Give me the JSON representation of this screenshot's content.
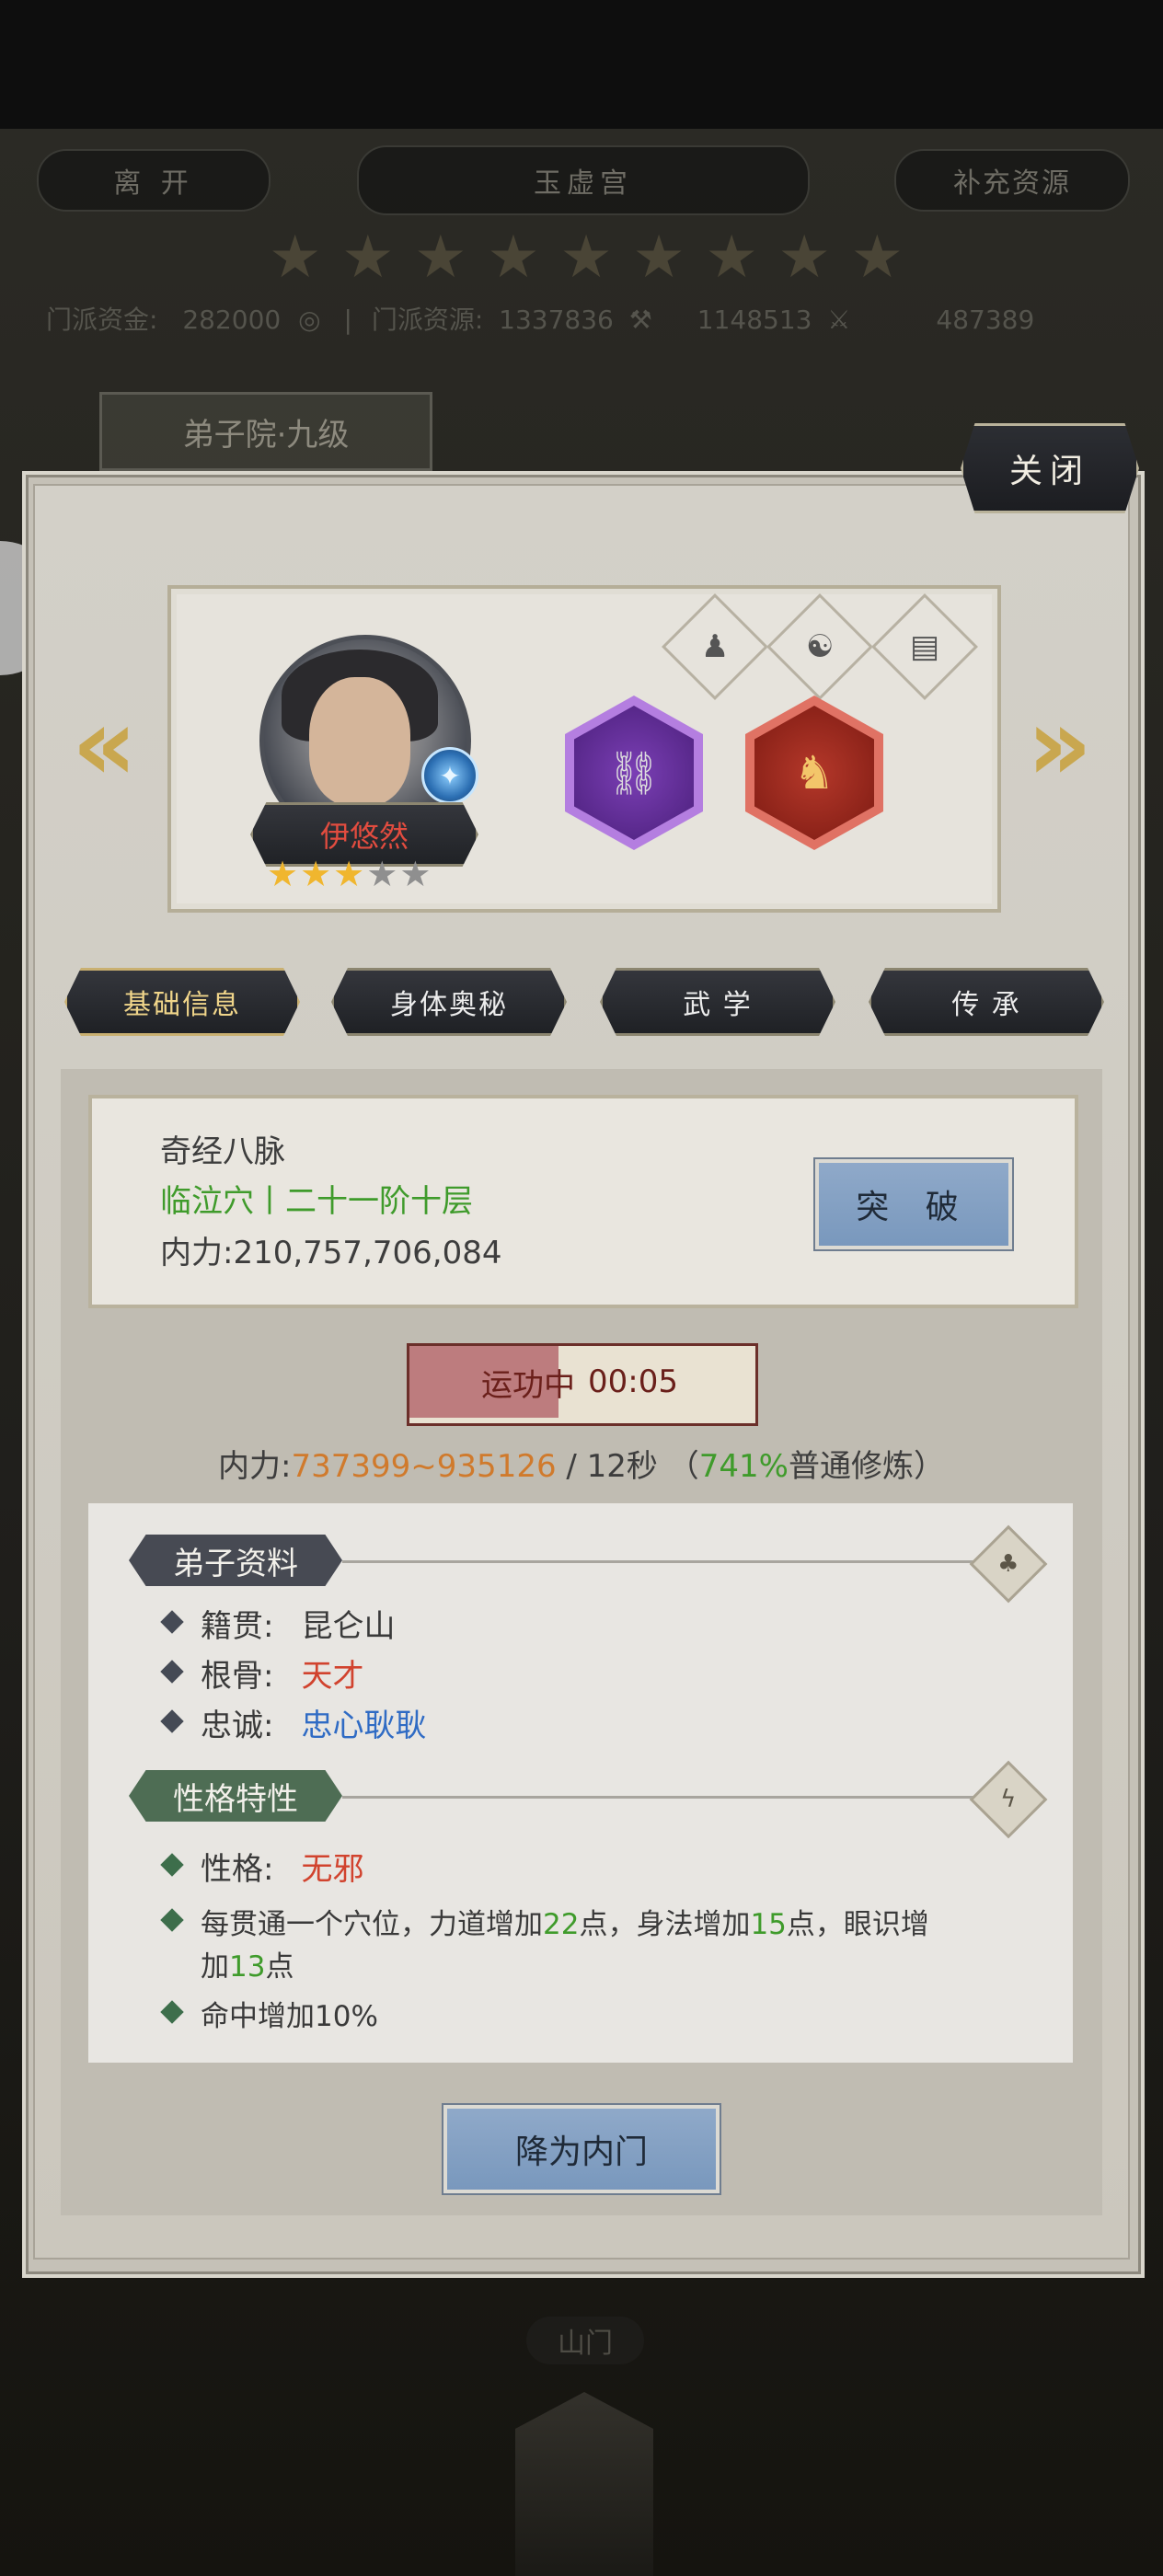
{
  "top": {
    "leave_label": "离 开",
    "sect_name": "玉虚宫",
    "replenish_label": "补充资源",
    "star_count": 9,
    "resources": {
      "funds_label": "门派资金:",
      "funds_value": "282000",
      "res_label": "门派资源:",
      "res_value": "1337836",
      "res3_value": "1148513",
      "res4_value": "487389"
    },
    "hall_label": "弟子院·九级"
  },
  "modal": {
    "close_label": "关闭",
    "character": {
      "name": "伊悠然",
      "stars_total": 5,
      "stars_filled": 3
    },
    "tabs": [
      "基础信息",
      "身体奥秘",
      "武 学",
      "传 承"
    ],
    "active_tab": 0,
    "cultivation": {
      "title": "奇经八脉",
      "stage": "临泣穴丨二十一阶十层",
      "power_label": "内力:",
      "power_value": "210,757,706,084",
      "break_label": "突 破"
    },
    "running": {
      "status": "运功中",
      "timer": "00:05",
      "progress": 0.43
    },
    "rate": {
      "label": "内力:",
      "range": "737399~935126",
      "per": "/ 12秒",
      "open": "（",
      "percent": "741%",
      "mode": "普通修炼）"
    },
    "profile": {
      "section_title": "弟子资料",
      "rows": [
        {
          "label": "籍贯:",
          "value": "昆仑山",
          "color": "#3a3a3a"
        },
        {
          "label": "根骨:",
          "value": "天才",
          "color": "#d1432e"
        },
        {
          "label": "忠诚:",
          "value": "忠心耿耿",
          "color": "#2f6bc4"
        }
      ]
    },
    "traits": {
      "section_title": "性格特性",
      "personality_label": "性格:",
      "personality_value": "无邪",
      "trait1_a": "每贯通一个穴位，力道增加",
      "trait1_b": "22",
      "trait1_c": "点，身法增加",
      "trait1_d": "15",
      "trait1_e": "点，眼识增",
      "trait1_f": "加",
      "trait1_g": "13",
      "trait1_h": "点",
      "trait2": "命中增加10%"
    },
    "demote_label": "降为内门"
  },
  "bottom": {
    "gate_label": "山门"
  }
}
